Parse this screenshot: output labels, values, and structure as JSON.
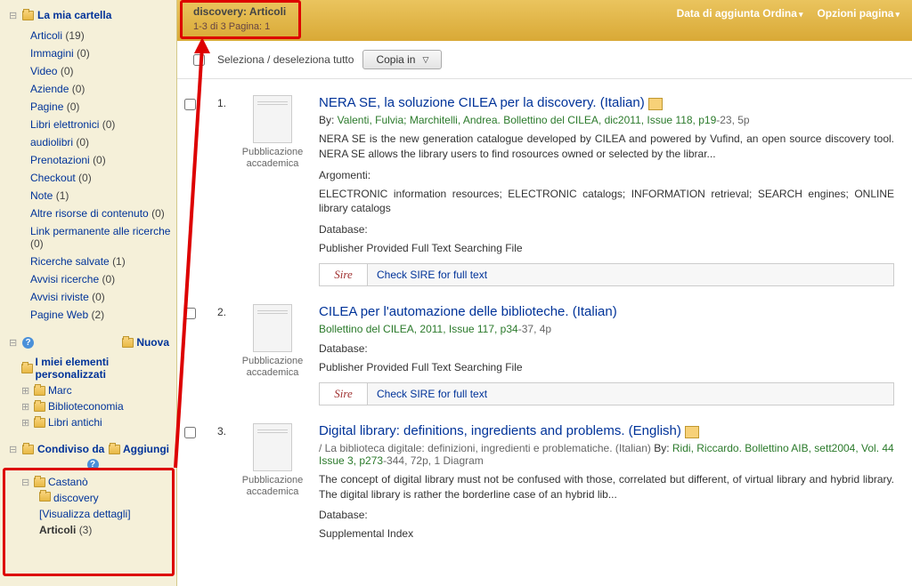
{
  "sidebar": {
    "my_folder": "La mia cartella",
    "items": [
      {
        "label": "Articoli",
        "count": "(19)"
      },
      {
        "label": "Immagini",
        "count": "(0)"
      },
      {
        "label": "Video",
        "count": "(0)"
      },
      {
        "label": "Aziende",
        "count": "(0)"
      },
      {
        "label": "Pagine",
        "count": "(0)"
      },
      {
        "label": "Libri elettronici",
        "count": "(0)"
      },
      {
        "label": "audiolibri",
        "count": "(0)"
      },
      {
        "label": "Prenotazioni",
        "count": "(0)"
      },
      {
        "label": "Checkout",
        "count": "(0)"
      },
      {
        "label": "Note",
        "count": "(1)"
      },
      {
        "label": "Altre risorse di contenuto",
        "count": "(0)"
      },
      {
        "label": "Link permanente alle ricerche",
        "count": "(0)"
      },
      {
        "label": "Ricerche salvate",
        "count": "(1)"
      },
      {
        "label": "Avvisi ricerche",
        "count": "(0)"
      },
      {
        "label": "Avvisi riviste",
        "count": "(0)"
      },
      {
        "label": "Pagine Web",
        "count": "(2)"
      }
    ],
    "nuova": "Nuova",
    "my_custom": "I miei elementi personalizzati",
    "tree": [
      {
        "label": "Marc"
      },
      {
        "label": "Biblioteconomia"
      },
      {
        "label": "Libri antichi"
      }
    ],
    "shared_with": "Condiviso da",
    "aggiungi": "Aggiungi",
    "castano": "Castanò",
    "discovery": "discovery",
    "view_details": "Visualizza dettagli",
    "articoli_shared": "Articoli",
    "articoli_shared_count": "(3)"
  },
  "topbar": {
    "breadcrumb": "discovery: Articoli",
    "pageinfo": "1-3 di 3   Pagina: 1",
    "sort_label": "Data di aggiunta Ordina",
    "page_options": "Opzioni pagina"
  },
  "toolbar": {
    "select_all": "Seleziona / deseleziona tutto",
    "copy_in": "Copia in"
  },
  "thumb_label": "Pubblicazione accademica",
  "results": [
    {
      "num": "1.",
      "title": "NERA SE, la soluzione CILEA per la discovery. (Italian)",
      "byline_prefix": "By: ",
      "authors": "Valenti, Fulvia; Marchitelli, Andrea",
      "source": ". Bollettino del CILEA, dic2011, Issue 118, p19",
      "source_suffix": "-23, 5p",
      "abstract": "NERA SE is the new generation catalogue developed by CILEA and powered by Vufind, an open source discovery tool. NERA SE allows the library users to find rosources owned or selected by the librar...",
      "argomenti_label": "Argomenti:",
      "argomenti": "ELECTRONIC information resources; ELECTRONIC catalogs; INFORMATION retrieval; SEARCH engines; ONLINE library catalogs",
      "db_label": "Database:",
      "db": "Publisher Provided Full Text Searching File",
      "sire": "Check SIRE for full text"
    },
    {
      "num": "2.",
      "title": "CILEA per l'automazione delle biblioteche. (Italian)",
      "source": "Bollettino del CILEA, 2011, Issue 117, p34",
      "source_suffix": "-37, 4p",
      "db_label": "Database:",
      "db": "Publisher Provided Full Text Searching File",
      "sire": "Check SIRE for full text"
    },
    {
      "num": "3.",
      "title": "Digital library: definitions, ingredients and problems. (English)",
      "alt_title": "/ La biblioteca digitale: definizioni, ingredienti e problematiche. (Italian) ",
      "byline_prefix": "By: ",
      "authors": "Ridi, Riccardo",
      "source": ". Bollettino AIB, sett2004, Vol. 44 Issue 3, p273",
      "source_suffix": "-344, 72p, 1 Diagram",
      "abstract": "The concept of digital library must not be confused with those, correlated but different, of virtual library and hybrid library. The digital library is rather the borderline case of an hybrid lib...",
      "db_label": "Database:",
      "db": "Supplemental Index"
    }
  ],
  "sire_logo": "Sire"
}
